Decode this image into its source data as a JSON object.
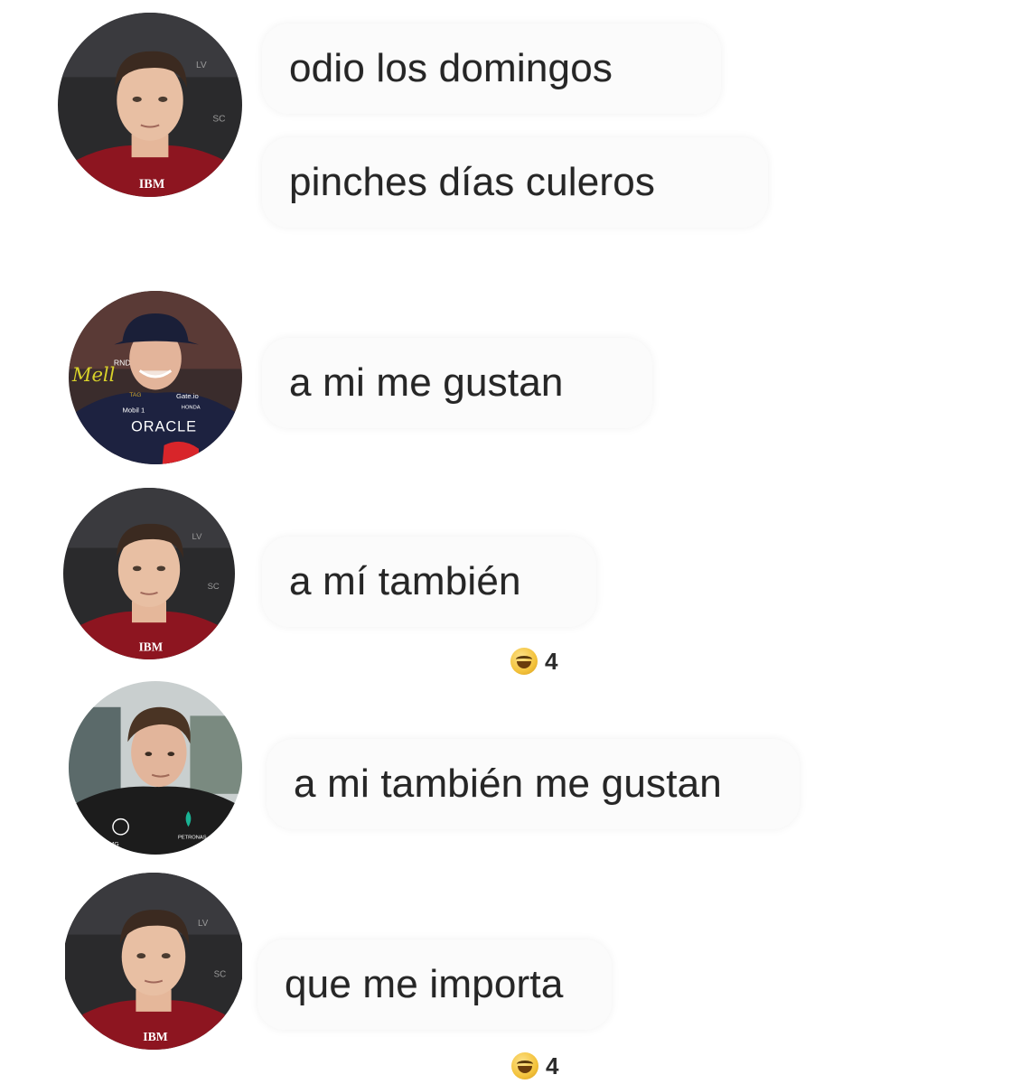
{
  "messages": [
    {
      "avatar": "red-suit-driver-avatar",
      "bubbles": [
        "odio los domingos",
        "pinches días culeros"
      ]
    },
    {
      "avatar": "navy-cap-driver-avatar",
      "bubbles": [
        "a mi me gustan"
      ],
      "avatar_badges": [
        "Mell",
        "RND",
        "TAG",
        "Gate.io",
        "HONDA",
        "Mobil 1",
        "ORACLE"
      ]
    },
    {
      "avatar": "red-suit-driver-avatar",
      "bubbles": [
        "a mí también"
      ],
      "reaction": {
        "icon": "laughing-face-emoji",
        "count": "4"
      }
    },
    {
      "avatar": "black-jacket-driver-avatar",
      "bubbles": [
        "a mi también me gustan"
      ],
      "avatar_badges": [
        "AMG",
        "PETRONAS"
      ]
    },
    {
      "avatar": "red-suit-driver-avatar",
      "bubbles": [
        "que me importa"
      ],
      "reaction": {
        "icon": "laughing-face-emoji",
        "count": "4"
      }
    }
  ],
  "red_suit_badges": [
    "IBM",
    "LV",
    "SC"
  ],
  "colors": {
    "background": "#ffffff",
    "bubble": "#fbfbfb",
    "text": "#262626",
    "red_suit": "#8d1520",
    "navy_suit": "#1d2240",
    "black_jacket": "#1c1c1c"
  }
}
